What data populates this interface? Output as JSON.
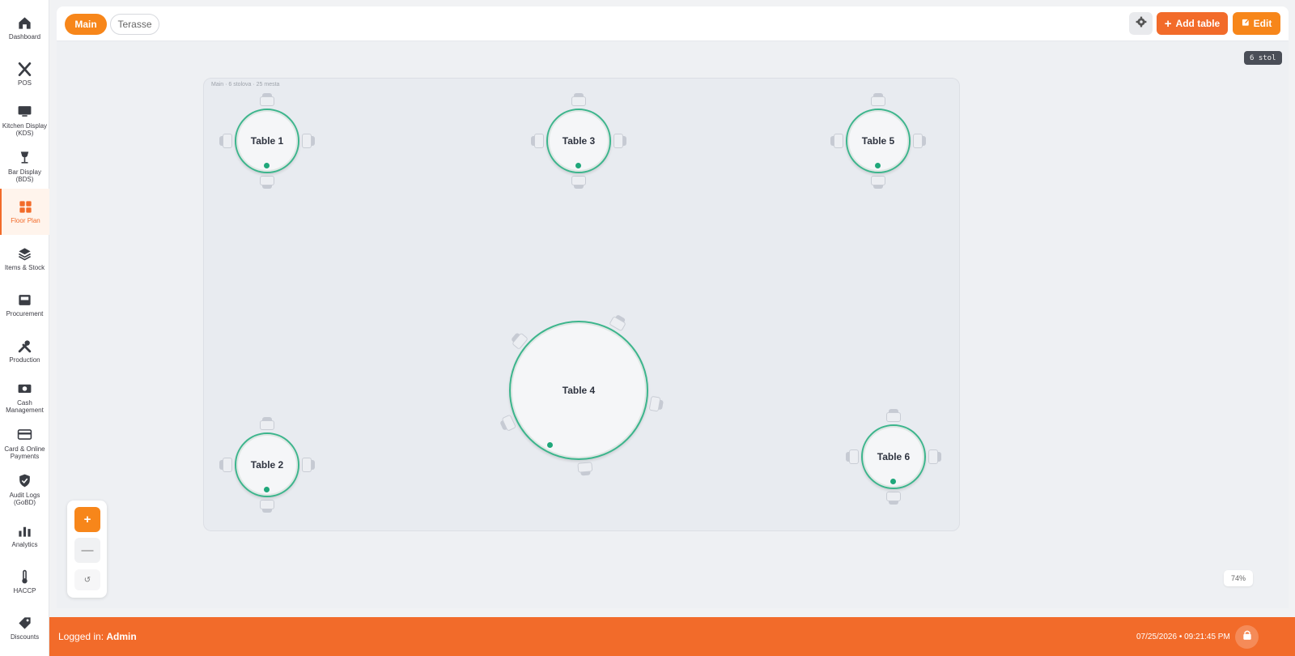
{
  "sidebar": {
    "items": [
      {
        "label": "Dashboard",
        "icon": "home-icon"
      },
      {
        "label": "POS",
        "icon": "utensils-icon"
      },
      {
        "label": "Kitchen Display (KDS)",
        "icon": "monitor-icon"
      },
      {
        "label": "Bar Display (BDS)",
        "icon": "wine-glass-icon"
      },
      {
        "label": "Floor Plan",
        "icon": "grid-icon",
        "active": true
      },
      {
        "label": "Items & Stock",
        "icon": "layers-icon"
      },
      {
        "label": "Procurement",
        "icon": "inbox-icon"
      },
      {
        "label": "Production",
        "icon": "tools-icon"
      },
      {
        "label": "Cash Management",
        "icon": "cash-icon"
      },
      {
        "label": "Card & Online Payments",
        "icon": "credit-card-icon"
      },
      {
        "label": "Audit Logs (GoBD)",
        "icon": "shield-check-icon"
      },
      {
        "label": "Analytics",
        "icon": "bar-chart-icon"
      },
      {
        "label": "HACCP",
        "icon": "thermometer-icon"
      },
      {
        "label": "Discounts",
        "icon": "tag-icon"
      }
    ]
  },
  "topbar": {
    "tabs": [
      {
        "label": "Main",
        "active": true
      },
      {
        "label": "Terasse",
        "active": false
      }
    ],
    "add_table_label": "Add table",
    "edit_label": "Edit"
  },
  "canvas": {
    "count_chip": "6 stol",
    "room_label": "Main · 6 stolova · 25 mesta",
    "zoom_percent": "74%",
    "zoom_in": "+",
    "zoom_out": "—",
    "zoom_reset": "↺"
  },
  "tables": [
    {
      "name": "Table 1",
      "status": "available"
    },
    {
      "name": "Table 3",
      "status": "available"
    },
    {
      "name": "Table 5",
      "status": "available"
    },
    {
      "name": "Table 4",
      "status": "available"
    },
    {
      "name": "Table 2",
      "status": "available"
    },
    {
      "name": "Table 6",
      "status": "available"
    }
  ],
  "footer": {
    "logged_prefix": "Logged in: ",
    "user": "Admin",
    "datetime": "07/25/2026 • 09:21:45 PM"
  },
  "colors": {
    "accent": "#f26b2a",
    "accent_light": "#f7861a",
    "table_ring": "#3cb58c",
    "status_available": "#1fa77a"
  }
}
